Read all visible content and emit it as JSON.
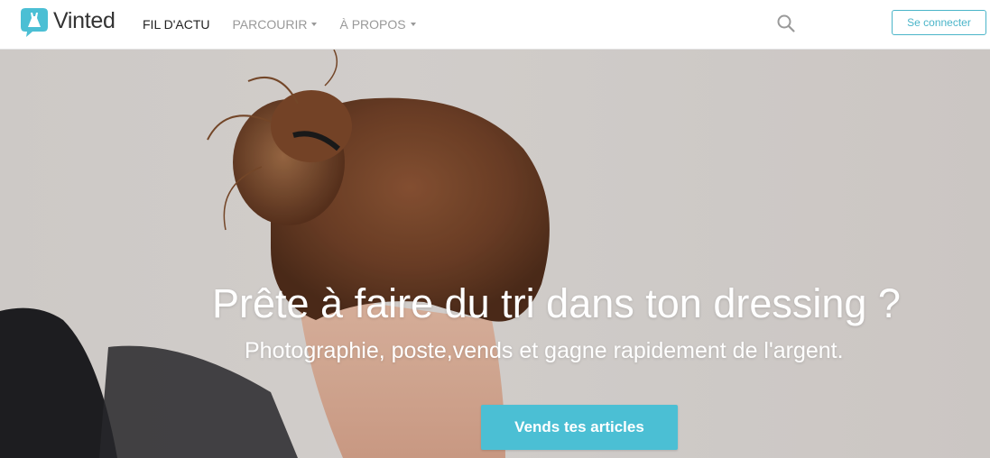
{
  "brand": {
    "name": "Vinted",
    "accent": "#4bbfd4"
  },
  "nav": {
    "items": [
      {
        "label": "FIL D'ACTU",
        "active": true,
        "dropdown": false
      },
      {
        "label": "PARCOURIR",
        "active": false,
        "dropdown": true
      },
      {
        "label": "À PROPOS",
        "active": false,
        "dropdown": true
      }
    ]
  },
  "header": {
    "search_icon": "search-icon",
    "login_label": "Se connecter"
  },
  "hero": {
    "title": "Prête à faire du tri dans ton dressing ?",
    "subtitle": "Photographie, poste,vends et gagne rapidement de l'argent.",
    "cta_label": "Vends tes articles"
  }
}
